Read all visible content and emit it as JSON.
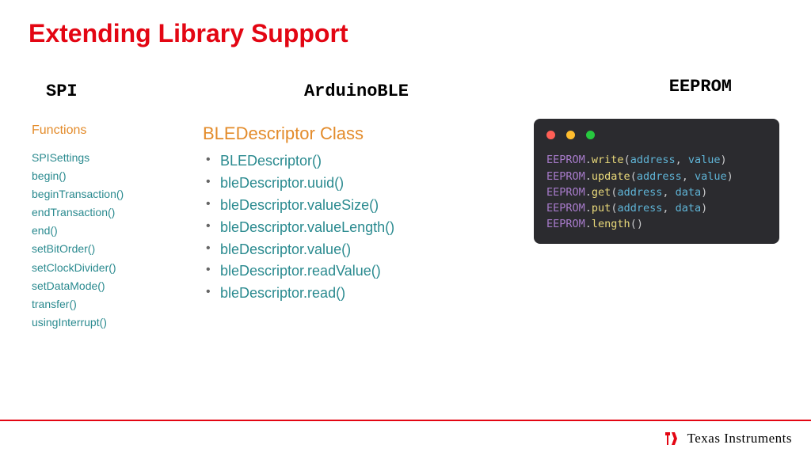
{
  "title": "Extending Library Support",
  "spi": {
    "header": "SPI",
    "section": "Functions",
    "items": [
      "SPISettings",
      "begin()",
      "beginTransaction()",
      "endTransaction()",
      "end()",
      "setBitOrder()",
      "setClockDivider()",
      "setDataMode()",
      "transfer()",
      "usingInterrupt()"
    ]
  },
  "ble": {
    "header": "ArduinoBLE",
    "class_title": "BLEDescriptor Class",
    "items": [
      "BLEDescriptor()",
      "bleDescriptor.uuid()",
      "bleDescriptor.valueSize()",
      "bleDescriptor.valueLength()",
      "bleDescriptor.value()",
      "bleDescriptor.readValue()",
      "bleDescriptor.read()"
    ]
  },
  "eeprom": {
    "header": "EEPROM",
    "lines": [
      {
        "obj": "EEPROM",
        "fn": "write",
        "args": [
          "address",
          "value"
        ]
      },
      {
        "obj": "EEPROM",
        "fn": "update",
        "args": [
          "address",
          "value"
        ]
      },
      {
        "obj": "EEPROM",
        "fn": "get",
        "args": [
          "address",
          "data"
        ]
      },
      {
        "obj": "EEPROM",
        "fn": "put",
        "args": [
          "address",
          "data"
        ]
      },
      {
        "obj": "EEPROM",
        "fn": "length",
        "args": []
      }
    ]
  },
  "footer": {
    "brand": "Texas Instruments"
  }
}
